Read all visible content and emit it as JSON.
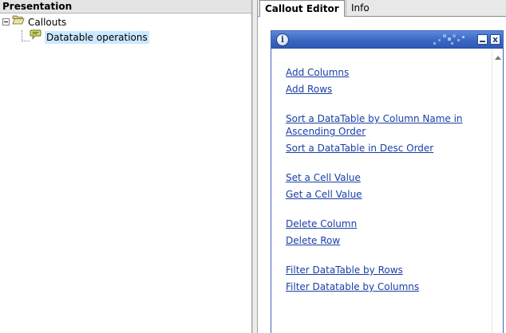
{
  "left_pane": {
    "header": "Presentation",
    "tree": {
      "root_label": "Callouts",
      "child_label": "Datatable operations"
    }
  },
  "tabs": [
    {
      "label": "Callout Editor",
      "active": true
    },
    {
      "label": "Info",
      "active": false
    }
  ],
  "callout": {
    "icon": "info-icon",
    "info_glyph": "i",
    "close_glyph": "x",
    "link_groups": [
      [
        "Add Columns",
        "Add Rows"
      ],
      [
        "Sort a DataTable by Column Name in Ascending Order",
        "Sort a DataTable in Desc Order"
      ],
      [
        "Set a Cell Value",
        "Get a Cell Value"
      ],
      [
        "Delete Column",
        "Delete Row"
      ],
      [
        "Filter DataTable by Rows",
        "Filter Datatable by Columns"
      ]
    ]
  },
  "colors": {
    "link": "#1a3fa6",
    "titlebar": "#3a67c3",
    "selection": "#cce8ff"
  }
}
